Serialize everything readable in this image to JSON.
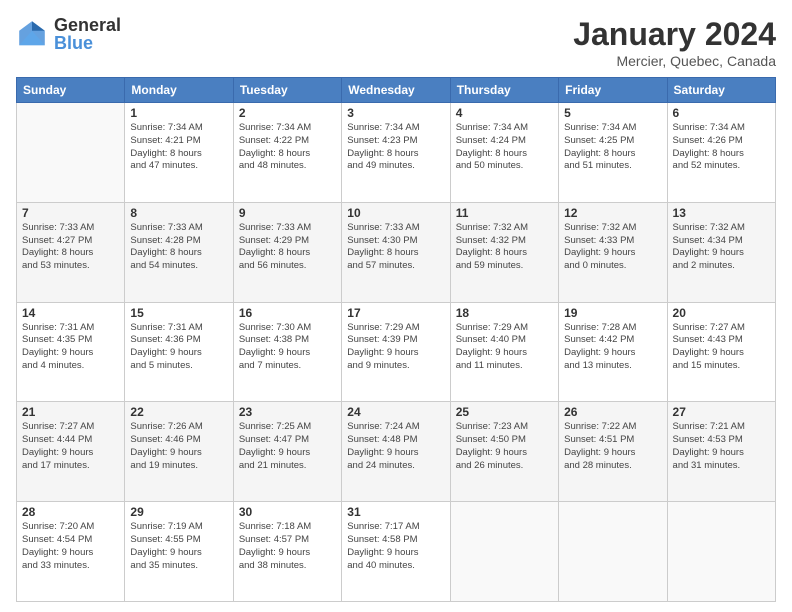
{
  "header": {
    "logo_general": "General",
    "logo_blue": "Blue",
    "month_title": "January 2024",
    "location": "Mercier, Quebec, Canada"
  },
  "days_of_week": [
    "Sunday",
    "Monday",
    "Tuesday",
    "Wednesday",
    "Thursday",
    "Friday",
    "Saturday"
  ],
  "weeks": [
    [
      {
        "day": "",
        "info": ""
      },
      {
        "day": "1",
        "info": "Sunrise: 7:34 AM\nSunset: 4:21 PM\nDaylight: 8 hours\nand 47 minutes."
      },
      {
        "day": "2",
        "info": "Sunrise: 7:34 AM\nSunset: 4:22 PM\nDaylight: 8 hours\nand 48 minutes."
      },
      {
        "day": "3",
        "info": "Sunrise: 7:34 AM\nSunset: 4:23 PM\nDaylight: 8 hours\nand 49 minutes."
      },
      {
        "day": "4",
        "info": "Sunrise: 7:34 AM\nSunset: 4:24 PM\nDaylight: 8 hours\nand 50 minutes."
      },
      {
        "day": "5",
        "info": "Sunrise: 7:34 AM\nSunset: 4:25 PM\nDaylight: 8 hours\nand 51 minutes."
      },
      {
        "day": "6",
        "info": "Sunrise: 7:34 AM\nSunset: 4:26 PM\nDaylight: 8 hours\nand 52 minutes."
      }
    ],
    [
      {
        "day": "7",
        "info": "Sunrise: 7:33 AM\nSunset: 4:27 PM\nDaylight: 8 hours\nand 53 minutes."
      },
      {
        "day": "8",
        "info": "Sunrise: 7:33 AM\nSunset: 4:28 PM\nDaylight: 8 hours\nand 54 minutes."
      },
      {
        "day": "9",
        "info": "Sunrise: 7:33 AM\nSunset: 4:29 PM\nDaylight: 8 hours\nand 56 minutes."
      },
      {
        "day": "10",
        "info": "Sunrise: 7:33 AM\nSunset: 4:30 PM\nDaylight: 8 hours\nand 57 minutes."
      },
      {
        "day": "11",
        "info": "Sunrise: 7:32 AM\nSunset: 4:32 PM\nDaylight: 8 hours\nand 59 minutes."
      },
      {
        "day": "12",
        "info": "Sunrise: 7:32 AM\nSunset: 4:33 PM\nDaylight: 9 hours\nand 0 minutes."
      },
      {
        "day": "13",
        "info": "Sunrise: 7:32 AM\nSunset: 4:34 PM\nDaylight: 9 hours\nand 2 minutes."
      }
    ],
    [
      {
        "day": "14",
        "info": "Sunrise: 7:31 AM\nSunset: 4:35 PM\nDaylight: 9 hours\nand 4 minutes."
      },
      {
        "day": "15",
        "info": "Sunrise: 7:31 AM\nSunset: 4:36 PM\nDaylight: 9 hours\nand 5 minutes."
      },
      {
        "day": "16",
        "info": "Sunrise: 7:30 AM\nSunset: 4:38 PM\nDaylight: 9 hours\nand 7 minutes."
      },
      {
        "day": "17",
        "info": "Sunrise: 7:29 AM\nSunset: 4:39 PM\nDaylight: 9 hours\nand 9 minutes."
      },
      {
        "day": "18",
        "info": "Sunrise: 7:29 AM\nSunset: 4:40 PM\nDaylight: 9 hours\nand 11 minutes."
      },
      {
        "day": "19",
        "info": "Sunrise: 7:28 AM\nSunset: 4:42 PM\nDaylight: 9 hours\nand 13 minutes."
      },
      {
        "day": "20",
        "info": "Sunrise: 7:27 AM\nSunset: 4:43 PM\nDaylight: 9 hours\nand 15 minutes."
      }
    ],
    [
      {
        "day": "21",
        "info": "Sunrise: 7:27 AM\nSunset: 4:44 PM\nDaylight: 9 hours\nand 17 minutes."
      },
      {
        "day": "22",
        "info": "Sunrise: 7:26 AM\nSunset: 4:46 PM\nDaylight: 9 hours\nand 19 minutes."
      },
      {
        "day": "23",
        "info": "Sunrise: 7:25 AM\nSunset: 4:47 PM\nDaylight: 9 hours\nand 21 minutes."
      },
      {
        "day": "24",
        "info": "Sunrise: 7:24 AM\nSunset: 4:48 PM\nDaylight: 9 hours\nand 24 minutes."
      },
      {
        "day": "25",
        "info": "Sunrise: 7:23 AM\nSunset: 4:50 PM\nDaylight: 9 hours\nand 26 minutes."
      },
      {
        "day": "26",
        "info": "Sunrise: 7:22 AM\nSunset: 4:51 PM\nDaylight: 9 hours\nand 28 minutes."
      },
      {
        "day": "27",
        "info": "Sunrise: 7:21 AM\nSunset: 4:53 PM\nDaylight: 9 hours\nand 31 minutes."
      }
    ],
    [
      {
        "day": "28",
        "info": "Sunrise: 7:20 AM\nSunset: 4:54 PM\nDaylight: 9 hours\nand 33 minutes."
      },
      {
        "day": "29",
        "info": "Sunrise: 7:19 AM\nSunset: 4:55 PM\nDaylight: 9 hours\nand 35 minutes."
      },
      {
        "day": "30",
        "info": "Sunrise: 7:18 AM\nSunset: 4:57 PM\nDaylight: 9 hours\nand 38 minutes."
      },
      {
        "day": "31",
        "info": "Sunrise: 7:17 AM\nSunset: 4:58 PM\nDaylight: 9 hours\nand 40 minutes."
      },
      {
        "day": "",
        "info": ""
      },
      {
        "day": "",
        "info": ""
      },
      {
        "day": "",
        "info": ""
      }
    ]
  ]
}
